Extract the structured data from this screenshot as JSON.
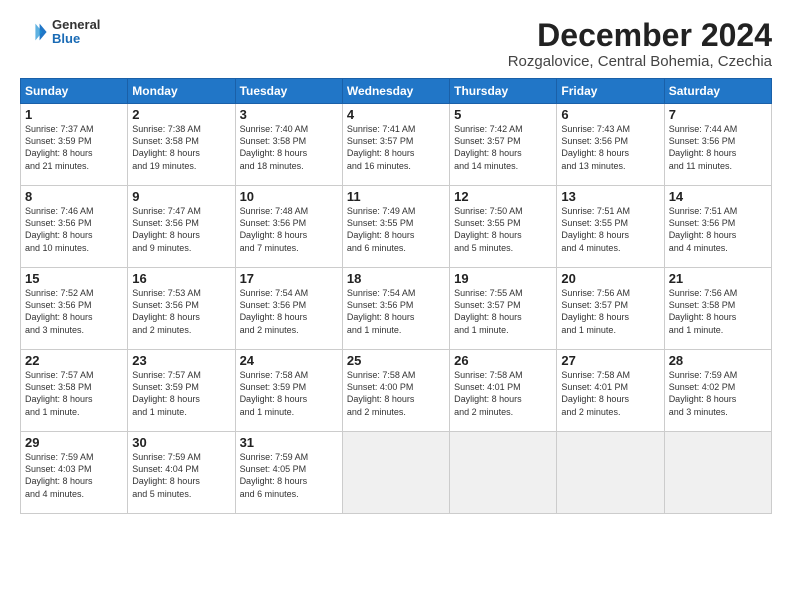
{
  "logo": {
    "general": "General",
    "blue": "Blue"
  },
  "title": "December 2024",
  "location": "Rozgalovice, Central Bohemia, Czechia",
  "weekdays": [
    "Sunday",
    "Monday",
    "Tuesday",
    "Wednesday",
    "Thursday",
    "Friday",
    "Saturday"
  ],
  "weeks": [
    [
      {
        "day": "1",
        "info": "Sunrise: 7:37 AM\nSunset: 3:59 PM\nDaylight: 8 hours\nand 21 minutes."
      },
      {
        "day": "2",
        "info": "Sunrise: 7:38 AM\nSunset: 3:58 PM\nDaylight: 8 hours\nand 19 minutes."
      },
      {
        "day": "3",
        "info": "Sunrise: 7:40 AM\nSunset: 3:58 PM\nDaylight: 8 hours\nand 18 minutes."
      },
      {
        "day": "4",
        "info": "Sunrise: 7:41 AM\nSunset: 3:57 PM\nDaylight: 8 hours\nand 16 minutes."
      },
      {
        "day": "5",
        "info": "Sunrise: 7:42 AM\nSunset: 3:57 PM\nDaylight: 8 hours\nand 14 minutes."
      },
      {
        "day": "6",
        "info": "Sunrise: 7:43 AM\nSunset: 3:56 PM\nDaylight: 8 hours\nand 13 minutes."
      },
      {
        "day": "7",
        "info": "Sunrise: 7:44 AM\nSunset: 3:56 PM\nDaylight: 8 hours\nand 11 minutes."
      }
    ],
    [
      {
        "day": "8",
        "info": "Sunrise: 7:46 AM\nSunset: 3:56 PM\nDaylight: 8 hours\nand 10 minutes."
      },
      {
        "day": "9",
        "info": "Sunrise: 7:47 AM\nSunset: 3:56 PM\nDaylight: 8 hours\nand 9 minutes."
      },
      {
        "day": "10",
        "info": "Sunrise: 7:48 AM\nSunset: 3:56 PM\nDaylight: 8 hours\nand 7 minutes."
      },
      {
        "day": "11",
        "info": "Sunrise: 7:49 AM\nSunset: 3:55 PM\nDaylight: 8 hours\nand 6 minutes."
      },
      {
        "day": "12",
        "info": "Sunrise: 7:50 AM\nSunset: 3:55 PM\nDaylight: 8 hours\nand 5 minutes."
      },
      {
        "day": "13",
        "info": "Sunrise: 7:51 AM\nSunset: 3:55 PM\nDaylight: 8 hours\nand 4 minutes."
      },
      {
        "day": "14",
        "info": "Sunrise: 7:51 AM\nSunset: 3:56 PM\nDaylight: 8 hours\nand 4 minutes."
      }
    ],
    [
      {
        "day": "15",
        "info": "Sunrise: 7:52 AM\nSunset: 3:56 PM\nDaylight: 8 hours\nand 3 minutes."
      },
      {
        "day": "16",
        "info": "Sunrise: 7:53 AM\nSunset: 3:56 PM\nDaylight: 8 hours\nand 2 minutes."
      },
      {
        "day": "17",
        "info": "Sunrise: 7:54 AM\nSunset: 3:56 PM\nDaylight: 8 hours\nand 2 minutes."
      },
      {
        "day": "18",
        "info": "Sunrise: 7:54 AM\nSunset: 3:56 PM\nDaylight: 8 hours\nand 1 minute."
      },
      {
        "day": "19",
        "info": "Sunrise: 7:55 AM\nSunset: 3:57 PM\nDaylight: 8 hours\nand 1 minute."
      },
      {
        "day": "20",
        "info": "Sunrise: 7:56 AM\nSunset: 3:57 PM\nDaylight: 8 hours\nand 1 minute."
      },
      {
        "day": "21",
        "info": "Sunrise: 7:56 AM\nSunset: 3:58 PM\nDaylight: 8 hours\nand 1 minute."
      }
    ],
    [
      {
        "day": "22",
        "info": "Sunrise: 7:57 AM\nSunset: 3:58 PM\nDaylight: 8 hours\nand 1 minute."
      },
      {
        "day": "23",
        "info": "Sunrise: 7:57 AM\nSunset: 3:59 PM\nDaylight: 8 hours\nand 1 minute."
      },
      {
        "day": "24",
        "info": "Sunrise: 7:58 AM\nSunset: 3:59 PM\nDaylight: 8 hours\nand 1 minute."
      },
      {
        "day": "25",
        "info": "Sunrise: 7:58 AM\nSunset: 4:00 PM\nDaylight: 8 hours\nand 2 minutes."
      },
      {
        "day": "26",
        "info": "Sunrise: 7:58 AM\nSunset: 4:01 PM\nDaylight: 8 hours\nand 2 minutes."
      },
      {
        "day": "27",
        "info": "Sunrise: 7:58 AM\nSunset: 4:01 PM\nDaylight: 8 hours\nand 2 minutes."
      },
      {
        "day": "28",
        "info": "Sunrise: 7:59 AM\nSunset: 4:02 PM\nDaylight: 8 hours\nand 3 minutes."
      }
    ],
    [
      {
        "day": "29",
        "info": "Sunrise: 7:59 AM\nSunset: 4:03 PM\nDaylight: 8 hours\nand 4 minutes."
      },
      {
        "day": "30",
        "info": "Sunrise: 7:59 AM\nSunset: 4:04 PM\nDaylight: 8 hours\nand 5 minutes."
      },
      {
        "day": "31",
        "info": "Sunrise: 7:59 AM\nSunset: 4:05 PM\nDaylight: 8 hours\nand 6 minutes."
      },
      null,
      null,
      null,
      null
    ]
  ]
}
